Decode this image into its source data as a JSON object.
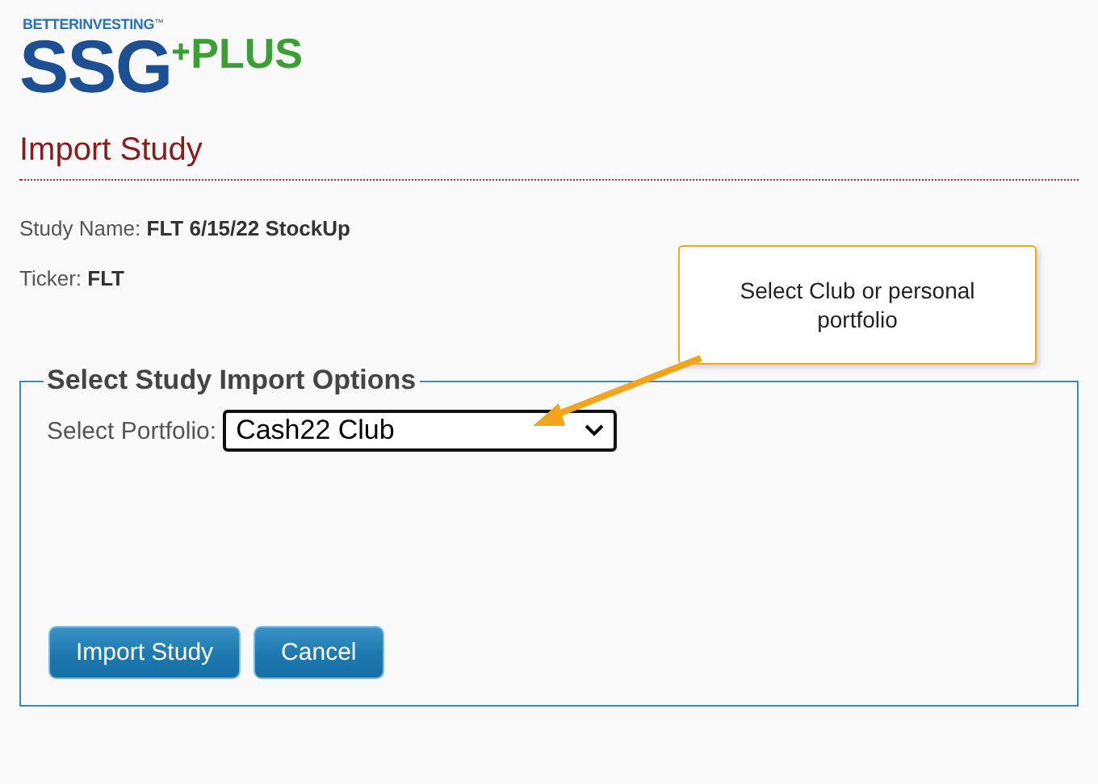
{
  "logo": {
    "brand": "BETTERINVESTING",
    "trademark": "™",
    "main": "SSG",
    "suffix": "PLUS"
  },
  "page_title": "Import Study",
  "study_name": {
    "label": "Study Name:",
    "value": "FLT 6/15/22 StockUp"
  },
  "ticker": {
    "label": "Ticker:",
    "value": "FLT"
  },
  "options": {
    "legend": "Select Study Import Options",
    "portfolio_label": "Select Portfolio:",
    "portfolio_value": "Cash22 Club"
  },
  "buttons": [
    "Import Study",
    "Cancel"
  ],
  "callout": {
    "text": "Select Club or personal portfolio"
  }
}
